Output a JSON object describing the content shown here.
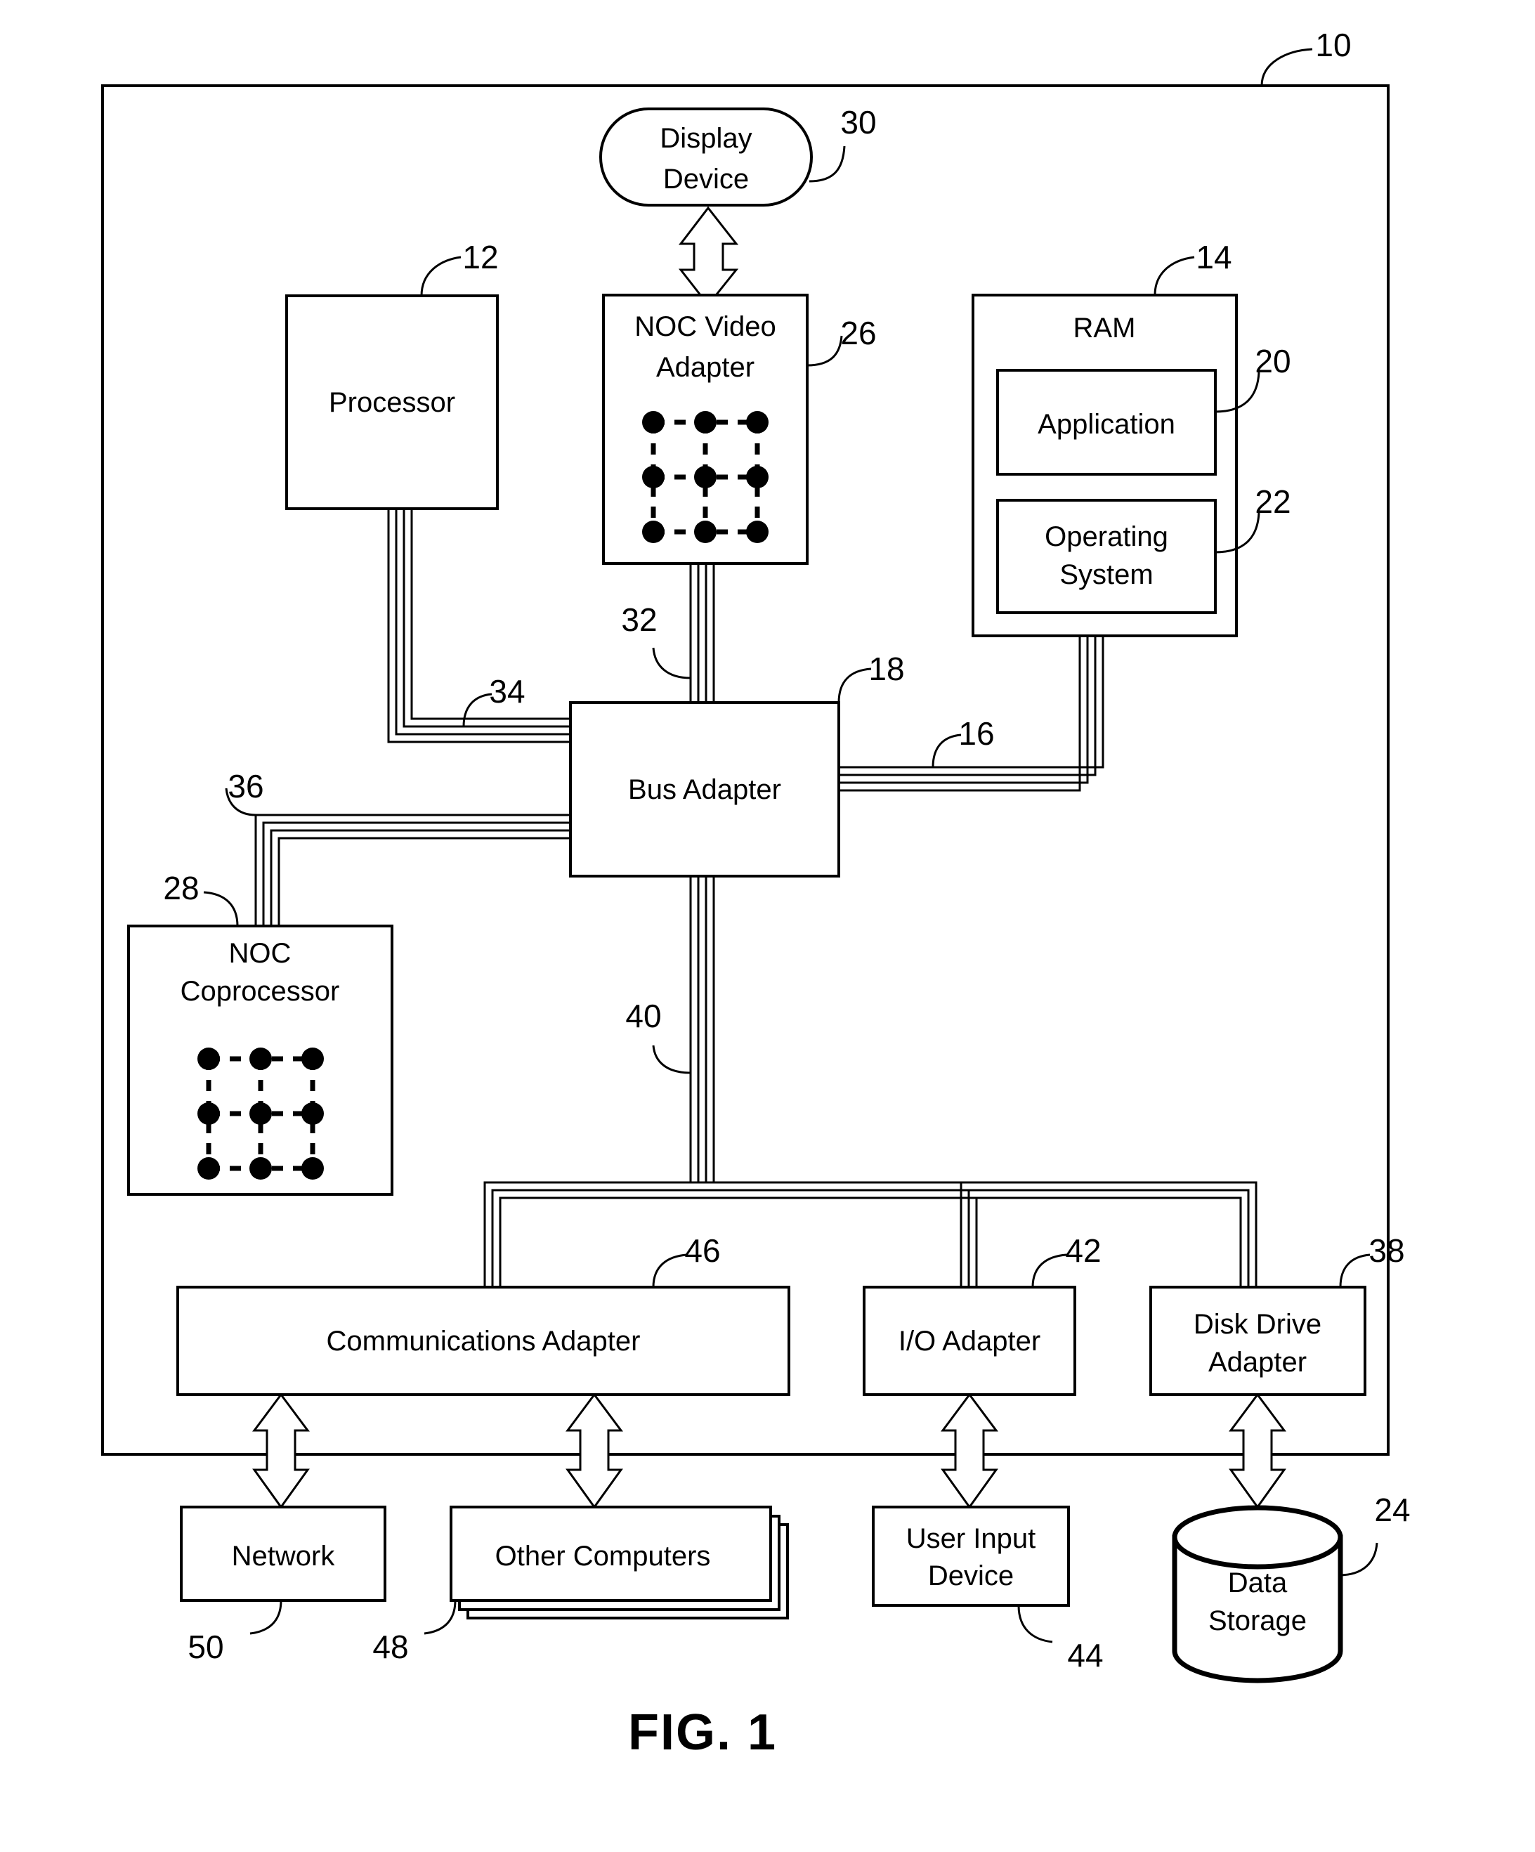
{
  "figure": {
    "caption": "FIG. 1",
    "outer_ref": "10"
  },
  "nodes": {
    "display_device": {
      "label_line1": "Display",
      "label_line2": "Device",
      "ref": "30"
    },
    "noc_video_adapter": {
      "label_line1": "NOC Video",
      "label_line2": "Adapter",
      "ref": "26"
    },
    "processor": {
      "label": "Processor",
      "ref": "12"
    },
    "ram": {
      "label": "RAM",
      "ref": "14"
    },
    "application": {
      "label": "Application",
      "ref": "20"
    },
    "operating_system": {
      "label_line1": "Operating",
      "label_line2": "System",
      "ref": "22"
    },
    "bus_adapter": {
      "label": "Bus Adapter",
      "ref": "18"
    },
    "noc_coprocessor": {
      "label_line1": "NOC",
      "label_line2": "Coprocessor",
      "ref": "28"
    },
    "communications_adapter": {
      "label": "Communications Adapter",
      "ref": "46"
    },
    "io_adapter": {
      "label": "I/O Adapter",
      "ref": "42"
    },
    "disk_drive_adapter": {
      "label_line1": "Disk Drive",
      "label_line2": "Adapter",
      "ref": "38"
    },
    "network": {
      "label": "Network",
      "ref": "50"
    },
    "other_computers": {
      "label": "Other Computers",
      "ref": "48"
    },
    "user_input_device": {
      "label_line1": "User Input",
      "label_line2": "Device",
      "ref": "44"
    },
    "data_storage": {
      "label_line1": "Data",
      "label_line2": "Storage",
      "ref": "24"
    }
  },
  "buses": {
    "memory_bus": {
      "ref": "16"
    },
    "front_side_bus": {
      "ref": "34"
    },
    "video_bus": {
      "ref": "32"
    },
    "coprocessor_bus": {
      "ref": "36"
    },
    "expansion_bus": {
      "ref": "40"
    }
  },
  "mesh": {
    "rows": 3,
    "cols": 3,
    "node_count": 9,
    "link_style": "dashed"
  },
  "colors": {
    "stroke": "#000000",
    "fill": "#ffffff"
  }
}
